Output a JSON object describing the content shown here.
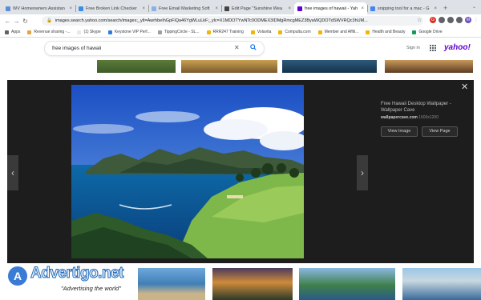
{
  "browser": {
    "tabs": [
      {
        "title": "WV Homeowners Assistan",
        "favicon_color": "#5a8fd8",
        "active": false
      },
      {
        "title": "Free Broken Link Checker",
        "favicon_color": "#3a8ee6",
        "active": false
      },
      {
        "title": "Free Email Marketing Soft",
        "favicon_color": "#8bb0e8",
        "active": false
      },
      {
        "title": "Edit Page \"Sunshine Wea",
        "favicon_color": "#444444",
        "active": false
      },
      {
        "title": "free images of hawaii - Yah",
        "favicon_color": "#6001d2",
        "active": true
      },
      {
        "title": "snipping tool for a mac - G",
        "favicon_color": "#4285f4",
        "active": false
      }
    ],
    "new_tab": "+",
    "window_control": "⌄",
    "url": "images.search.yahoo.com/search/images;_ylt=AwrhbeIhGpFiQa46YgWLuLkF;_ylc=X1MDOTYwNTc0ODMEX3IDMgRmcgMEZ3ByaWQDOTdSWVRQc3hUM...",
    "extensions": [
      {
        "label": "G",
        "color": "#d93025"
      },
      {
        "label": "",
        "color": "#5f6368"
      },
      {
        "label": "",
        "color": "#5f6368"
      },
      {
        "label": "",
        "color": "#5f6368"
      },
      {
        "label": "M",
        "color": "#6b4fbb"
      }
    ]
  },
  "bookmarks": [
    {
      "label": "Apps",
      "color": "#5f6368"
    },
    {
      "label": "Revenue sharing -...",
      "color": "#e8a33c"
    },
    {
      "label": "(1) Skype",
      "color": "#e8e8e8"
    },
    {
      "label": "Keystone VIP Perf...",
      "color": "#2b7de9"
    },
    {
      "label": "TippingCircle - SL...",
      "color": "#9aa0a6"
    },
    {
      "label": "RRR247 Training",
      "color": "#f4b400"
    },
    {
      "label": "Volavita",
      "color": "#f4b400"
    },
    {
      "label": "Compulta.com",
      "color": "#f4b400"
    },
    {
      "label": "Member and Affili...",
      "color": "#f4b400"
    },
    {
      "label": "Health and Beauty",
      "color": "#f4b400"
    },
    {
      "label": "Google Drive",
      "color": "#0f9d58"
    }
  ],
  "yahoo": {
    "query": "free images of hawaii",
    "sign_in": "Sign in",
    "logo": "yahoo!"
  },
  "viewer": {
    "title": "Free Hawaii Desktop Wallpaper - Wallpaper Cave",
    "source": "wallpapercave.com",
    "dimensions": "1600x1200",
    "view_image_label": "View Image",
    "view_page_label": "View Page"
  },
  "watermark": {
    "name": "Advertigo.net",
    "tagline": "\"Advertising the world\""
  },
  "colors": {
    "overlay_bg": "#1d1d1d",
    "yahoo_purple": "#6001d2",
    "search_blue": "#1a73e8"
  }
}
